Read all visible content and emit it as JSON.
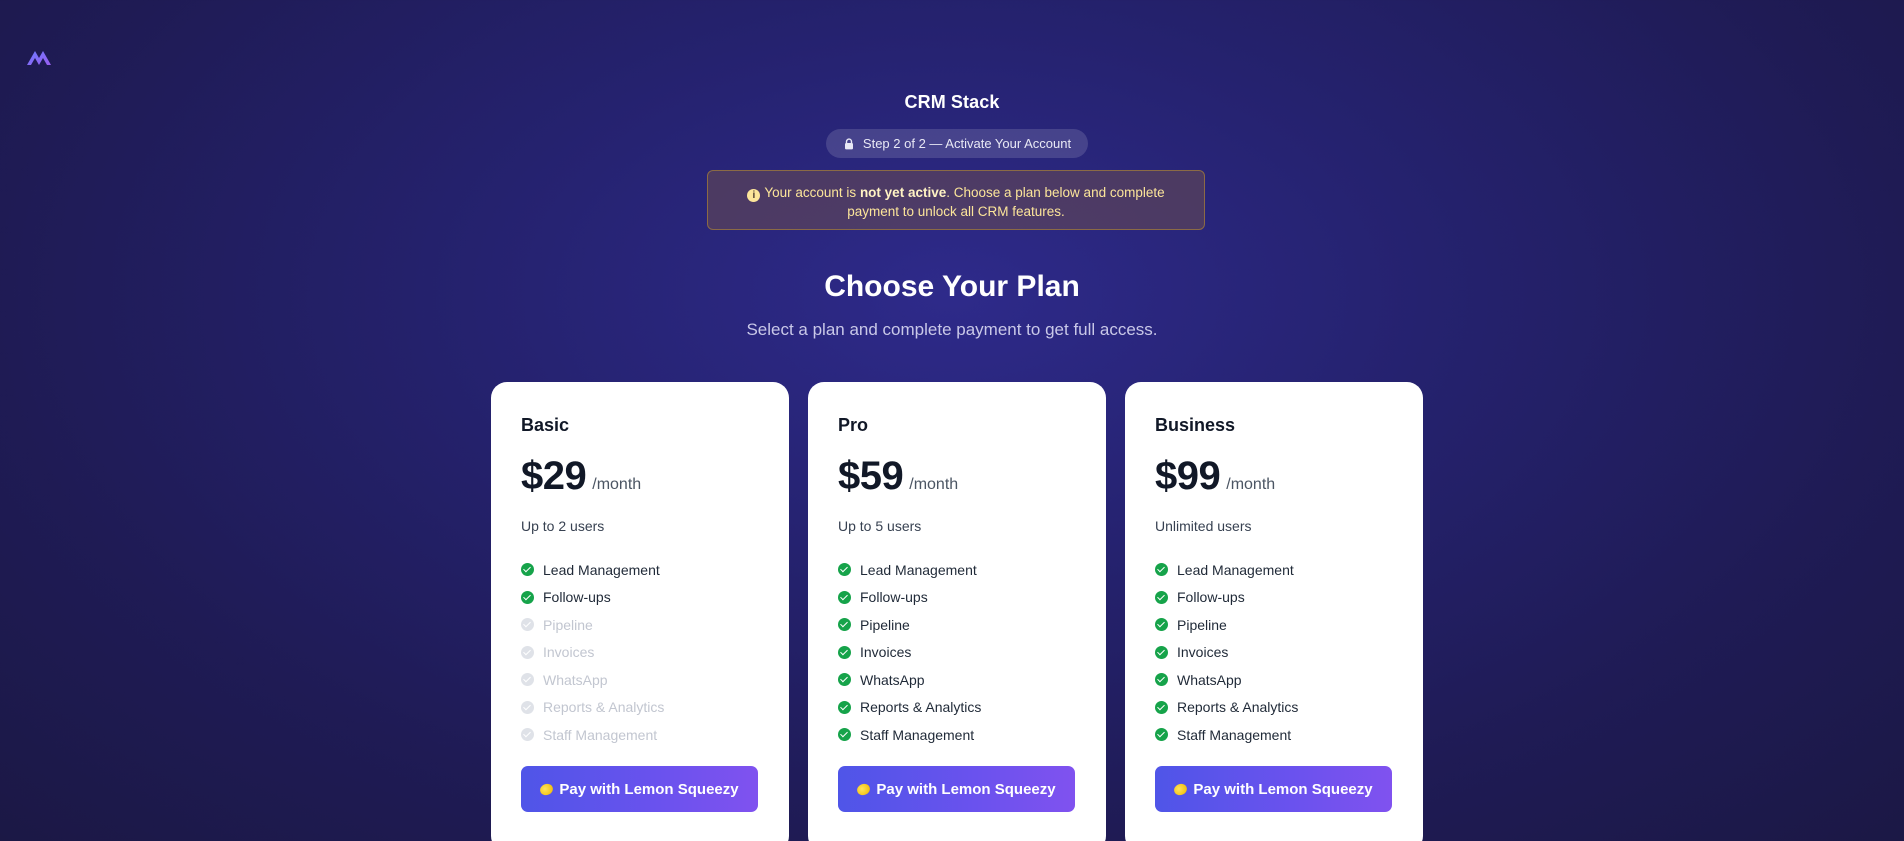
{
  "header": {
    "app_name": "CRM Stack",
    "step_label": "Step 2 of 2 — Activate Your Account"
  },
  "alert": {
    "prefix": "Your account is ",
    "emphasis": "not yet active",
    "suffix": ". Choose a plan below and complete payment to unlock all CRM features."
  },
  "main": {
    "title": "Choose Your Plan",
    "subtitle": "Select a plan and complete payment to get full access."
  },
  "plans": [
    {
      "name": "Basic",
      "price": "$29",
      "period": "/month",
      "users": "Up to 2 users",
      "button_label": "Pay with Lemon Squeezy",
      "features": [
        {
          "label": "Lead Management",
          "included": true
        },
        {
          "label": "Follow-ups",
          "included": true
        },
        {
          "label": "Pipeline",
          "included": false
        },
        {
          "label": "Invoices",
          "included": false
        },
        {
          "label": "WhatsApp",
          "included": false
        },
        {
          "label": "Reports & Analytics",
          "included": false
        },
        {
          "label": "Staff Management",
          "included": false
        }
      ]
    },
    {
      "name": "Pro",
      "price": "$59",
      "period": "/month",
      "users": "Up to 5 users",
      "button_label": "Pay with Lemon Squeezy",
      "features": [
        {
          "label": "Lead Management",
          "included": true
        },
        {
          "label": "Follow-ups",
          "included": true
        },
        {
          "label": "Pipeline",
          "included": true
        },
        {
          "label": "Invoices",
          "included": true
        },
        {
          "label": "WhatsApp",
          "included": true
        },
        {
          "label": "Reports & Analytics",
          "included": true
        },
        {
          "label": "Staff Management",
          "included": true
        }
      ]
    },
    {
      "name": "Business",
      "price": "$99",
      "period": "/month",
      "users": "Unlimited users",
      "button_label": "Pay with Lemon Squeezy",
      "features": [
        {
          "label": "Lead Management",
          "included": true
        },
        {
          "label": "Follow-ups",
          "included": true
        },
        {
          "label": "Pipeline",
          "included": true
        },
        {
          "label": "Invoices",
          "included": true
        },
        {
          "label": "WhatsApp",
          "included": true
        },
        {
          "label": "Reports & Analytics",
          "included": true
        },
        {
          "label": "Staff Management",
          "included": true
        }
      ]
    }
  ],
  "colors": {
    "accent": "#5b54ec",
    "check_included": "#16a34a",
    "check_excluded": "#dfe2e8",
    "alert_text": "#fce59a"
  },
  "icons": {
    "logo": "brand-logo-icon",
    "step": "lock-icon",
    "alert": "info-icon",
    "feature_on": "check-circle-icon",
    "feature_off": "check-circle-muted-icon",
    "button": "lemon-icon"
  }
}
